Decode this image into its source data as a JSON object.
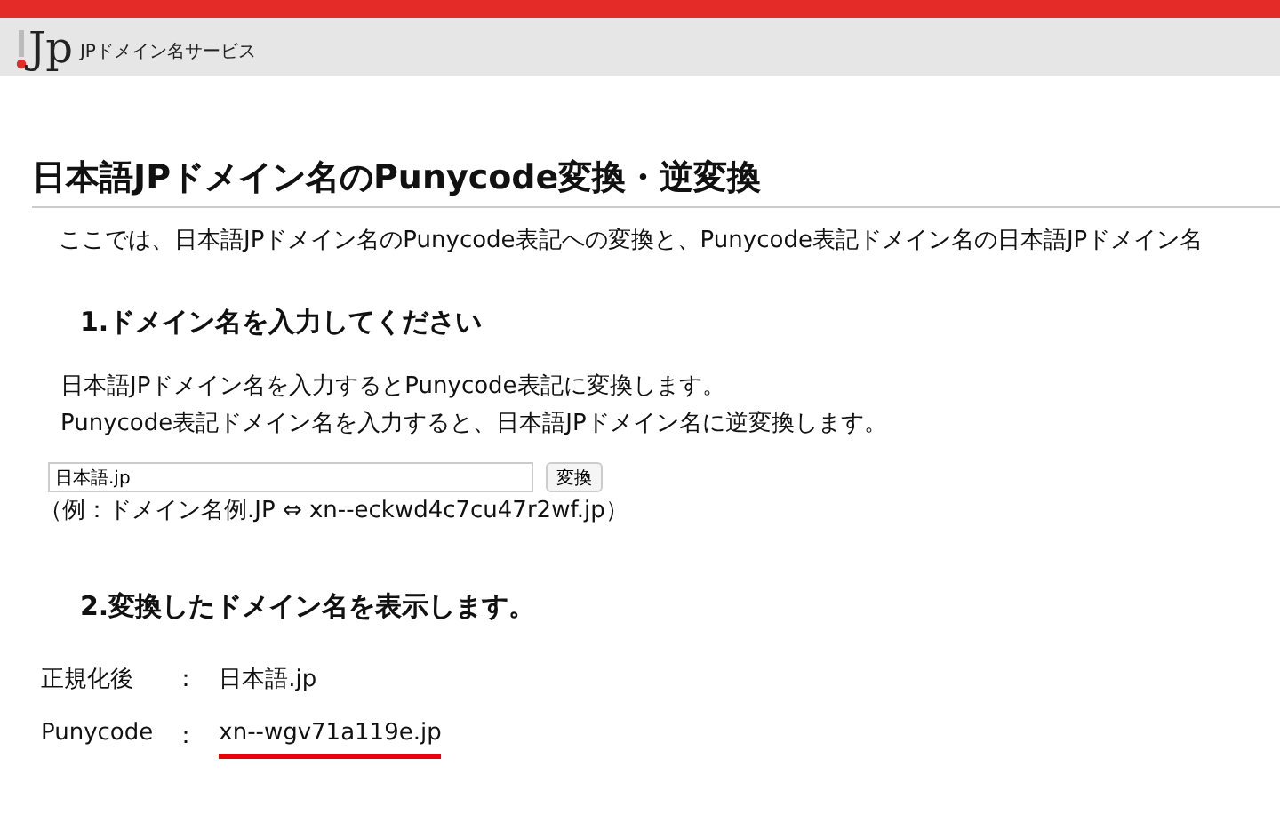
{
  "header": {
    "logo": "Jp",
    "service_name": "JPドメイン名サービス"
  },
  "title": "日本語JPドメイン名のPunycode変換・逆変換",
  "intro": "ここでは、日本語JPドメイン名のPunycode表記への変換と、Punycode表記ドメイン名の日本語JPドメイン名",
  "section1": {
    "heading": "1.ドメイン名を入力してください",
    "description": [
      "日本語JPドメイン名を入力するとPunycode表記に変換します。",
      "Punycode表記ドメイン名を入力すると、日本語JPドメイン名に逆変換します。"
    ],
    "input": {
      "value": "日本語.jp"
    },
    "button": "変換",
    "example": "（例：ドメイン名例.JP ⇔ xn--eckwd4c7cu47r2wf.jp）"
  },
  "section2": {
    "heading": "2.変換したドメイン名を表示します。",
    "results": [
      {
        "label": "正規化後",
        "separator": "：",
        "value": "日本語.jp",
        "highlighted": false
      },
      {
        "label": "Punycode",
        "separator": "：",
        "value": "xn--wgv71a119e.jp",
        "highlighted": true
      }
    ]
  }
}
